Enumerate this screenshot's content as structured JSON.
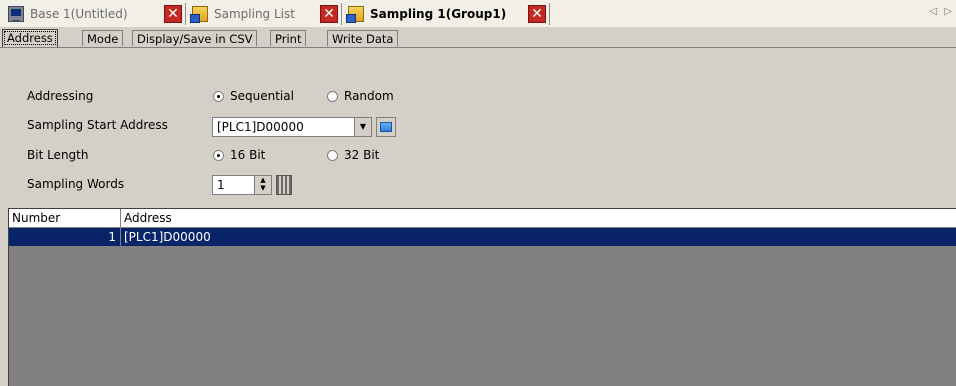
{
  "doc_tabs": [
    {
      "label": "Base 1(Untitled)",
      "icon": "screen-icon",
      "active": false
    },
    {
      "label": "Sampling List",
      "icon": "sampling-icon",
      "active": false
    },
    {
      "label": "Sampling 1(Group1)",
      "icon": "sampling-icon",
      "active": true
    }
  ],
  "nav_arrows": "◁ ▷",
  "property_tabs": [
    {
      "label": "Address",
      "active": true
    },
    {
      "label": "Mode",
      "active": false
    },
    {
      "label": "Display/Save in CSV",
      "active": false
    },
    {
      "label": "Print",
      "active": false
    },
    {
      "label": "Write Data",
      "active": false
    }
  ],
  "form": {
    "addressing_label": "Addressing",
    "addressing_options": [
      "Sequential",
      "Random"
    ],
    "addressing_selected": "Sequential",
    "start_address_label": "Sampling Start Address",
    "start_address_value": "[PLC1]D00000",
    "bit_length_label": "Bit Length",
    "bit_length_options": [
      "16 Bit",
      "32 Bit"
    ],
    "bit_length_selected": "16 Bit",
    "sampling_words_label": "Sampling Words",
    "sampling_words_value": "1"
  },
  "table": {
    "columns": [
      "Number",
      "Address"
    ],
    "rows": [
      {
        "number": "1",
        "address": "[PLC1]D00000",
        "selected": true
      }
    ]
  },
  "colors": {
    "selection": "#0a246a",
    "close_button": "#c52a22",
    "grid_background": "#808080"
  }
}
